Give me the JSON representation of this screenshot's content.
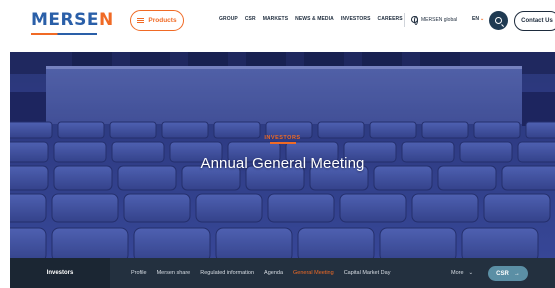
{
  "brand": {
    "logo_text_main": "MERSE",
    "logo_text_accent": "N"
  },
  "header": {
    "products_label": "Products",
    "nav": [
      "GROUP",
      "CSR",
      "MARKETS",
      "NEWS & MEDIA",
      "INVESTORS",
      "CAREERS"
    ],
    "global_label": "MERSEN global",
    "lang_label": "EN",
    "contact_label": "Contact Us"
  },
  "hero": {
    "kicker": "INVESTORS",
    "title": "Annual General Meeting"
  },
  "subbar": {
    "section_label": "Investors",
    "items": [
      "Profile",
      "Mersen share",
      "Regulated information",
      "Agenda",
      "General Meeting",
      "Capital Market Day"
    ],
    "active_item": "General Meeting",
    "more_label": "More",
    "csr_label": "CSR"
  },
  "colors": {
    "accent": "#f06a25",
    "navy": "#1d2b3c",
    "subbar": "#23303f",
    "csr": "#5b8fa5"
  }
}
